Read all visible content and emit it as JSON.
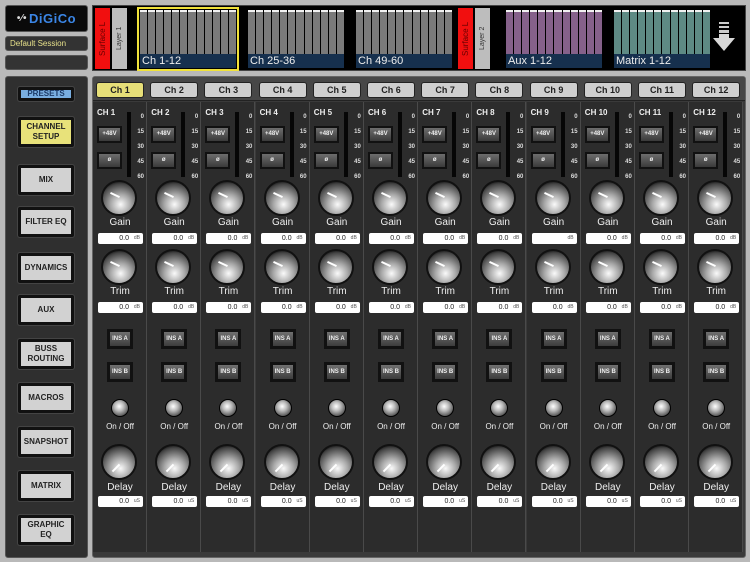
{
  "brand": {
    "logo_text": "DiGiCo",
    "session_name": "Default Session",
    "session_secondary": ""
  },
  "banks": {
    "surface_left_label": "Surface L",
    "layer1_label": "Layer 1",
    "layer2_label": "Layer 2",
    "items": [
      {
        "label": "Ch 1-12",
        "color": "#7a7a7a",
        "selected": true
      },
      {
        "label": "Ch 25-36",
        "color": "#7a7a7a",
        "selected": false
      },
      {
        "label": "Ch 49-60",
        "color": "#7a7a7a",
        "selected": false
      },
      {
        "label": "Aux 1-12",
        "color": "#85618a",
        "selected": false
      },
      {
        "label": "Matrix 1-12",
        "color": "#5e8a84",
        "selected": false
      }
    ],
    "scroll_icon": "down-arrow-icon"
  },
  "sidebar": {
    "items": [
      {
        "label": "PRESETS",
        "state": "presets"
      },
      {
        "label": "CHANNEL SETUP",
        "state": "active"
      },
      {
        "label": "MIX",
        "state": "normal"
      },
      {
        "label": "FILTER EQ",
        "state": "normal"
      },
      {
        "label": "DYNAMICS",
        "state": "normal"
      },
      {
        "label": "AUX",
        "state": "normal"
      },
      {
        "label": "BUSS ROUTING",
        "state": "normal"
      },
      {
        "label": "MACROS",
        "state": "normal"
      },
      {
        "label": "SNAPSHOT",
        "state": "normal"
      },
      {
        "label": "MATRIX",
        "state": "normal"
      },
      {
        "label": "GRAPHIC EQ",
        "state": "normal"
      }
    ]
  },
  "mixer": {
    "meter_scale": [
      "0",
      "15",
      "30",
      "45",
      "60"
    ],
    "labels": {
      "phantom": "+48V",
      "phase": "ø",
      "gain": "Gain",
      "trim": "Trim",
      "ins_a": "INS A",
      "ins_b": "INS B",
      "onoff": "On / Off",
      "delay": "Delay",
      "unit_db": "dB",
      "unit_us": "uS"
    },
    "channels": [
      {
        "tab": "Ch 1",
        "name": "CH 1",
        "selected": true,
        "gain": "0.0",
        "trim": "0.0",
        "delay": "0.0"
      },
      {
        "tab": "Ch 2",
        "name": "CH 2",
        "selected": false,
        "gain": "0.0",
        "trim": "0.0",
        "delay": "0.0"
      },
      {
        "tab": "Ch 3",
        "name": "CH 3",
        "selected": false,
        "gain": "0.0",
        "trim": "0.0",
        "delay": "0.0"
      },
      {
        "tab": "Ch 4",
        "name": "CH 4",
        "selected": false,
        "gain": "0.0",
        "trim": "0.0",
        "delay": "0.0"
      },
      {
        "tab": "Ch 5",
        "name": "CH 5",
        "selected": false,
        "gain": "0.0",
        "trim": "0.0",
        "delay": "0.0"
      },
      {
        "tab": "Ch 6",
        "name": "CH 6",
        "selected": false,
        "gain": "0.0",
        "trim": "0.0",
        "delay": "0.0"
      },
      {
        "tab": "Ch 7",
        "name": "CH 7",
        "selected": false,
        "gain": "0.0",
        "trim": "0.0",
        "delay": "0.0"
      },
      {
        "tab": "Ch 8",
        "name": "CH 8",
        "selected": false,
        "gain": "0.0",
        "trim": "0.0",
        "delay": "0.0"
      },
      {
        "tab": "Ch 9",
        "name": "CH 9",
        "selected": false,
        "gain": "",
        "trim": "0.0",
        "delay": "0.0"
      },
      {
        "tab": "Ch 10",
        "name": "CH 10",
        "selected": false,
        "gain": "0.0",
        "trim": "0.0",
        "delay": "0.0"
      },
      {
        "tab": "Ch 11",
        "name": "CH 11",
        "selected": false,
        "gain": "0.0",
        "trim": "0.0",
        "delay": "0.0"
      },
      {
        "tab": "Ch 12",
        "name": "CH 12",
        "selected": false,
        "gain": "0.0",
        "trim": "0.0",
        "delay": "0.0"
      }
    ]
  }
}
